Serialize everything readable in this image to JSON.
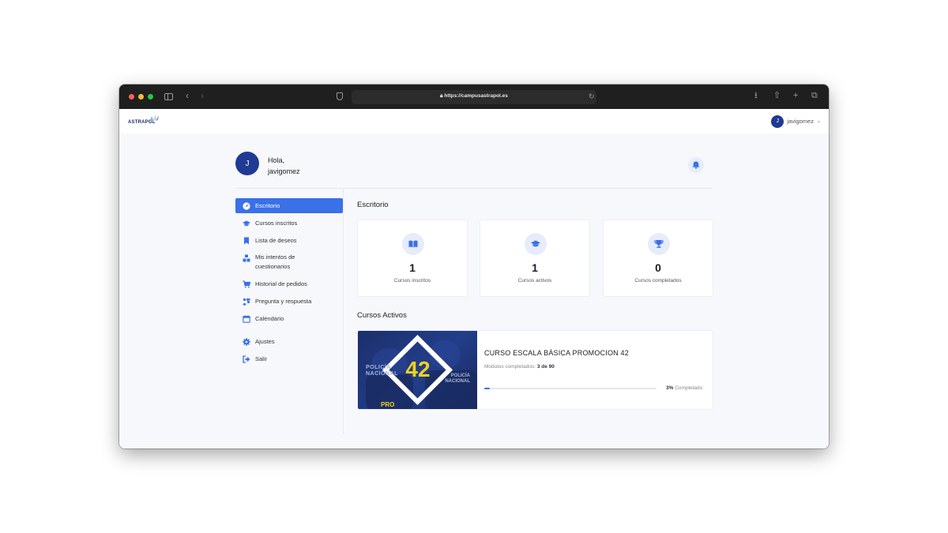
{
  "browser": {
    "url": "https://campusastrapol.es"
  },
  "app": {
    "logo_text": "ASTRAPOL",
    "user_initial": "J",
    "username": "javigomez"
  },
  "greeting": {
    "hello": "Hola,",
    "name": "javigomez",
    "avatar_initial": "J"
  },
  "sidebar": {
    "items": [
      {
        "label": "Escritorio",
        "icon": "dashboard-icon"
      },
      {
        "label": "Cursos inscritos",
        "icon": "graduation-cap-icon"
      },
      {
        "label": "Lista de deseos",
        "icon": "bookmark-icon"
      },
      {
        "label": "Mis intentos de cuestionarios",
        "icon": "quiz-icon"
      },
      {
        "label": "Historial de pedidos",
        "icon": "cart-icon"
      },
      {
        "label": "Pregunta y respuesta",
        "icon": "qa-icon"
      },
      {
        "label": "Calendario",
        "icon": "calendar-icon"
      },
      {
        "label": "Ajustes",
        "icon": "gear-icon"
      },
      {
        "label": "Salir",
        "icon": "logout-icon"
      }
    ]
  },
  "dashboard": {
    "title": "Escritorio",
    "stats": [
      {
        "value": "1",
        "label": "Cursos inscritos",
        "icon": "book-open-icon"
      },
      {
        "value": "1",
        "label": "Cursos activos",
        "icon": "graduation-cap-icon"
      },
      {
        "value": "0",
        "label": "Cursos completados",
        "icon": "trophy-icon"
      }
    ]
  },
  "active_courses": {
    "title": "Cursos Activos",
    "course": {
      "title": "CURSO ESCALA BÁSICA PROMOCION 42",
      "modules_label": "Modulos completados:",
      "modules_value": "3 de 90",
      "progress_percent": 3,
      "progress_value": "3%",
      "progress_suffix": "Completado",
      "thumb_number": "42",
      "thumb_badge": "PRO",
      "thumb_text_left": "POLICÍA NACIONAL",
      "thumb_text_right": "POLICÍA NACIONAL"
    }
  },
  "colors": {
    "accent": "#3a70e8",
    "navy": "#1f3a93",
    "thumb_yellow": "#f2d21b"
  }
}
